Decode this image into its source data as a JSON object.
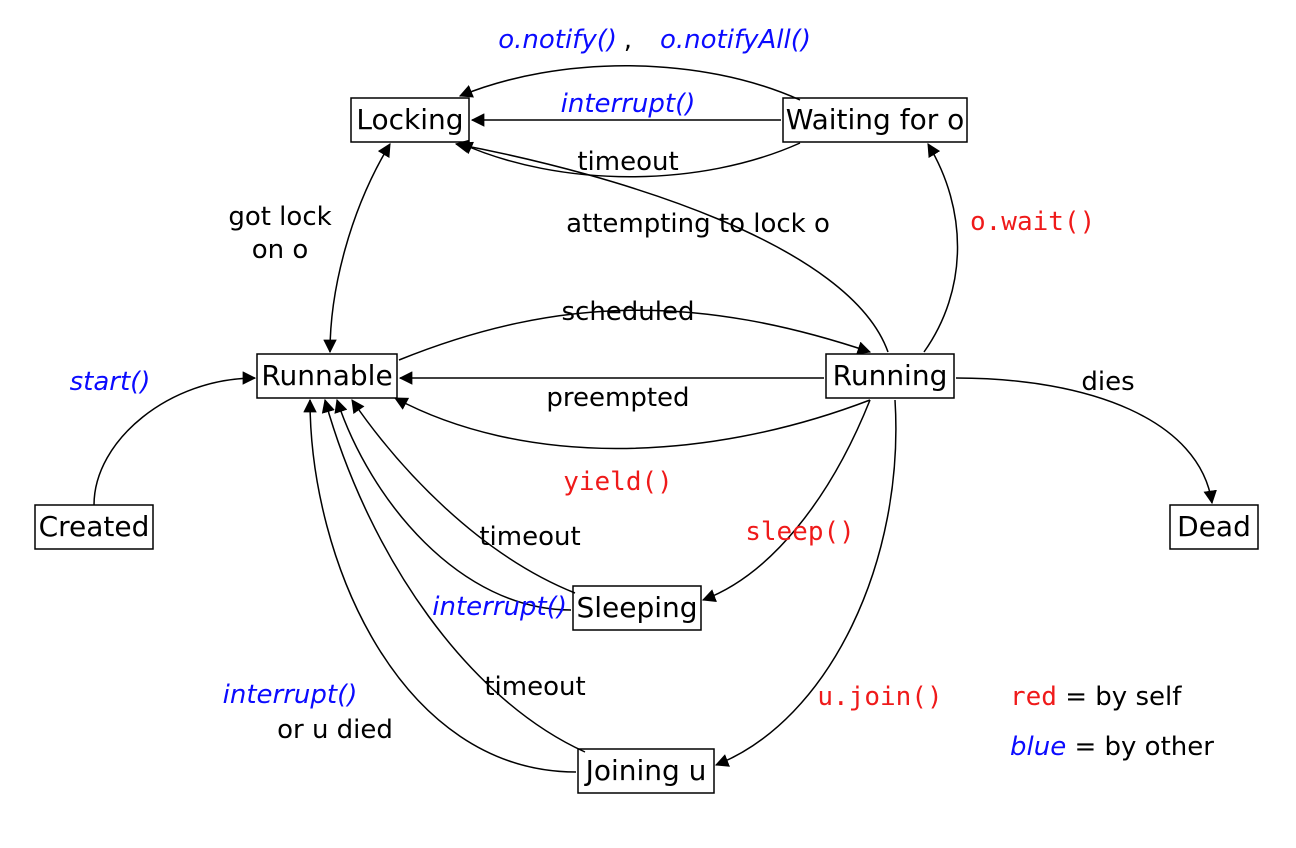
{
  "nodes": {
    "created": "Created",
    "runnable": "Runnable",
    "running": "Running",
    "dead": "Dead",
    "locking": "Locking",
    "waiting": "Waiting for o",
    "sleeping": "Sleeping",
    "joining": "Joining u"
  },
  "edges": {
    "start": "start()",
    "scheduled": "scheduled",
    "preempted": "preempted",
    "yield": "yield()",
    "dies": "dies",
    "sleep": "sleep()",
    "sleep_to": "timeout",
    "sleep_int": "interrupt()",
    "join": "u.join()",
    "join_to": "timeout",
    "join_int1": "interrupt()",
    "join_int2": "or u died",
    "wait": "o.wait()",
    "notify": "o.notify()",
    "notify_sep": ",",
    "notifyAll": "o.notifyAll()",
    "wait_int": "interrupt()",
    "wait_to": "timeout",
    "attempt": "attempting to lock o",
    "gotlock1": "got lock",
    "gotlock2": "on o"
  },
  "legend": {
    "red_code": "red",
    "red_text": " = by self",
    "blue_code": "blue",
    "blue_text": " = by other"
  }
}
